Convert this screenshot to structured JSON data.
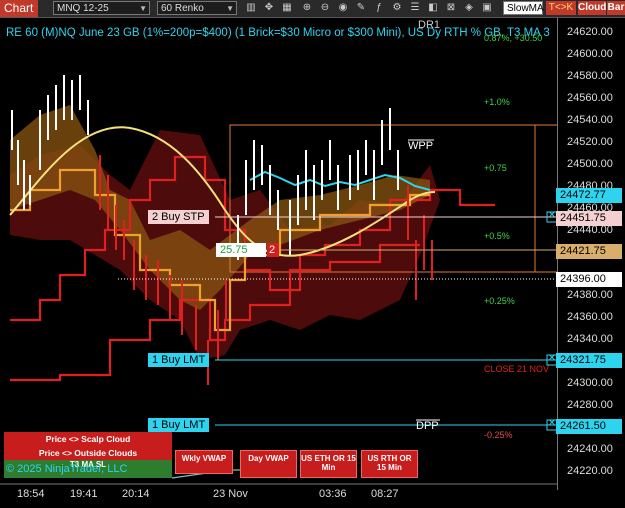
{
  "toolbar": {
    "chart_tab": "Chart",
    "instrument": "MNQ 12-25",
    "bar_type": "60 Renko",
    "indicator": "SlowMA",
    "link_label": "T<>K",
    "cloud_label": "Cloud",
    "bar_label": "Bar"
  },
  "chart_title": "RE 60 (M)NQ June 23 GB (1%=200p=$400) (1 Brick=$30 Micro or $300 Mini), US Dy RTH % GB, T3 MA 3",
  "right_axis": {
    "labels": [
      "24620.00",
      "24600.00",
      "24580.00",
      "24560.00",
      "24540.00",
      "24520.00",
      "24500.00",
      "24480.00",
      "24460.00",
      "24440.00",
      "24380.00",
      "24360.00",
      "24340.00",
      "24300.00",
      "24280.00",
      "24240.00",
      "24220.00"
    ],
    "tags": [
      {
        "value": "24472.77",
        "bg": "#2ed4ef",
        "fg": "#000"
      },
      {
        "value": "24451.75",
        "bg": "#f5d0d0",
        "fg": "#000"
      },
      {
        "value": "24421.75",
        "bg": "#d9ad6a",
        "fg": "#000"
      },
      {
        "value": "24396.00",
        "bg": "#ffffff",
        "fg": "#000"
      },
      {
        "value": "24321.75",
        "bg": "#2ed4ef",
        "fg": "#000"
      },
      {
        "value": "24261.50",
        "bg": "#2ed4ef",
        "fg": "#000"
      }
    ]
  },
  "x_axis": [
    "18:54",
    "19:41",
    "20:14",
    "23 Nov",
    "03:36",
    "08:27"
  ],
  "levels": {
    "dr1": "DR1",
    "top_pct": "0.87%, +30.50",
    "wpp": "WPP",
    "dpp": "DPP",
    "pct_1": "+1.0%",
    "pct_075": "+0.75",
    "pct_05": "+0.5%",
    "pct_025": "+0.25%",
    "close_label": "CLOSE 21 NOV",
    "neg_pct": "-0.25%"
  },
  "orders": {
    "buy_stp": "2 Buy STP",
    "buy_lmt_1": "1 Buy LMT",
    "buy_lmt_2": "1 Buy LMT",
    "price_box": "25.75",
    "qty_badge": "2"
  },
  "legend": {
    "scalp": "Price <> Scalp Cloud",
    "outside": "Price <> Outside Clouds",
    "t3": "T3 MA SL",
    "copyright": "© 2025 NinjaTrader, LLC"
  },
  "buttons": {
    "wkly_vwap": "Wkly VWAP",
    "day_vwap": "Day VWAP",
    "us_eth": "US ETH OR 15 Min",
    "us_rth": "US RTH OR 15 Min"
  },
  "colors": {
    "cyan": "#2ed4ef",
    "red": "#e02020",
    "orange": "#f0a030",
    "yellow": "#f3e27a",
    "green": "#3fd34a"
  }
}
